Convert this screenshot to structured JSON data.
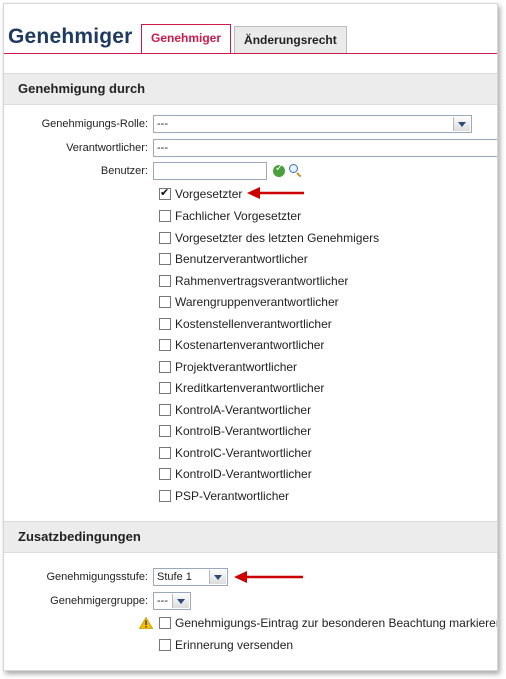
{
  "header": {
    "title": "Genehmiger",
    "tabs": [
      {
        "label": "Genehmiger",
        "active": true
      },
      {
        "label": "Änderungsrecht",
        "active": false
      }
    ]
  },
  "sections": {
    "approval": {
      "title": "Genehmigung durch",
      "role_label": "Genehmigungs-Rolle:",
      "role_value": "---",
      "responsible_label": "Verantwortlicher:",
      "responsible_value": "---",
      "user_label": "Benutzer:",
      "user_value": "",
      "checkboxes": [
        {
          "label": "Vorgesetzter",
          "checked": true
        },
        {
          "label": "Fachlicher Vorgesetzter",
          "checked": false
        },
        {
          "label": "Vorgesetzter des letzten Genehmigers",
          "checked": false
        },
        {
          "label": "Benutzerverantwortlicher",
          "checked": false
        },
        {
          "label": "Rahmenvertragsverantwortlicher",
          "checked": false
        },
        {
          "label": "Warengruppenverantwortlicher",
          "checked": false
        },
        {
          "label": "Kostenstellenverantwortlicher",
          "checked": false
        },
        {
          "label": "Kostenartenverantwortlicher",
          "checked": false
        },
        {
          "label": "Projektverantwortlicher",
          "checked": false
        },
        {
          "label": "Kreditkartenverantwortlicher",
          "checked": false
        },
        {
          "label": "KontrolA-Verantwortlicher",
          "checked": false
        },
        {
          "label": "KontrolB-Verantwortlicher",
          "checked": false
        },
        {
          "label": "KontrolC-Verantwortlicher",
          "checked": false
        },
        {
          "label": "KontrolD-Verantwortlicher",
          "checked": false
        },
        {
          "label": "PSP-Verantwortlicher",
          "checked": false
        }
      ]
    },
    "conditions": {
      "title": "Zusatzbedingungen",
      "level_label": "Genehmigungsstufe:",
      "level_value": "Stufe 1",
      "group_label": "Genehmigergruppe:",
      "group_value": "---",
      "checkboxes": [
        {
          "label": "Genehmigungs-Eintrag zur besonderen Beachtung markieren",
          "checked": false
        },
        {
          "label": "Erinnerung versenden",
          "checked": false
        }
      ]
    }
  },
  "colors": {
    "accent": "#cc1a4a",
    "title": "#1f3a60",
    "annotation_arrow": "#cc0000"
  }
}
